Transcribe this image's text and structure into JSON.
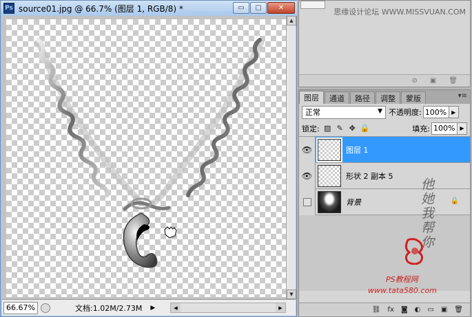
{
  "document": {
    "ps_badge": "Ps",
    "title": "source01.jpg @ 66.7% (图层 1, RGB/8) *",
    "controls": {
      "minimize": "▭",
      "restore": "▢",
      "close": "✕"
    },
    "zoom": "66.67%",
    "doc_info": "文档:1.02M/2.73M"
  },
  "top_panel": {
    "watermark": "思缘设计论坛 WWW.MISSVUAN.COM"
  },
  "layers_panel": {
    "tabs": [
      {
        "label": "图层",
        "active": true
      },
      {
        "label": "通道",
        "active": false
      },
      {
        "label": "路径",
        "active": false
      },
      {
        "label": "调整",
        "active": false
      },
      {
        "label": "蒙版",
        "active": false
      }
    ],
    "blend_mode": "正常",
    "opacity_label": "不透明度:",
    "opacity_value": "100%",
    "lock_label": "锁定:",
    "fill_label": "填充:",
    "fill_value": "100%",
    "layers": [
      {
        "name": "图层 1",
        "visible": true,
        "selected": true,
        "locked": false
      },
      {
        "name": "形状 2 副本 5",
        "visible": true,
        "selected": false,
        "locked": false
      },
      {
        "name": "背景",
        "visible": false,
        "selected": false,
        "locked": true
      }
    ]
  },
  "watermarks": {
    "side": "他她我帮你",
    "bottom": "PS教程网",
    "url": "www.tata580.com"
  }
}
